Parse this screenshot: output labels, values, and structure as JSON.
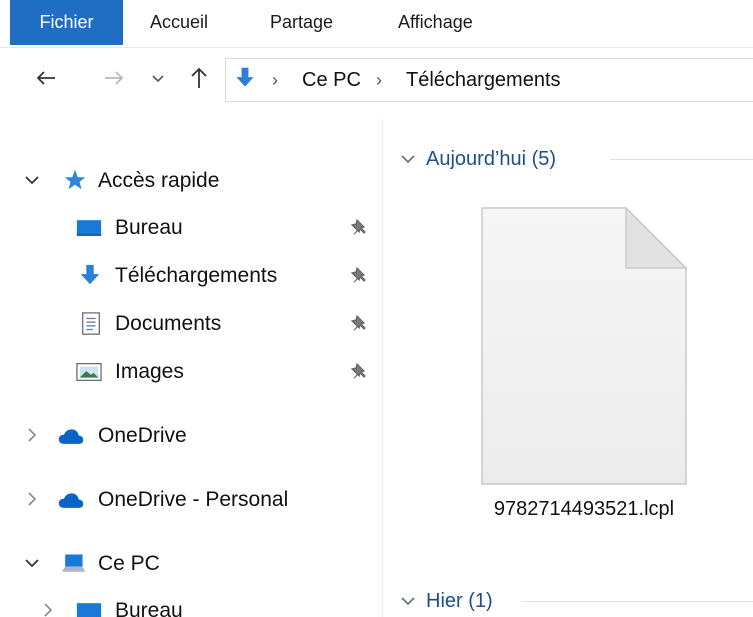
{
  "ribbon": {
    "tabs": [
      {
        "label": "Fichier",
        "active": true
      },
      {
        "label": "Accueil"
      },
      {
        "label": "Partage"
      },
      {
        "label": "Affichage"
      }
    ]
  },
  "address": {
    "crumbs": [
      "Ce PC",
      "Téléchargements"
    ]
  },
  "nav": {
    "quick_access": {
      "label": "Accès rapide",
      "expanded": true,
      "items": [
        {
          "label": "Bureau",
          "icon": "desktop-icon",
          "pinned": true
        },
        {
          "label": "Téléchargements",
          "icon": "download-arrow-icon",
          "pinned": true
        },
        {
          "label": "Documents",
          "icon": "document-icon",
          "pinned": true
        },
        {
          "label": "Images",
          "icon": "pictures-icon",
          "pinned": true
        }
      ]
    },
    "onedrive": {
      "label": "OneDrive",
      "expanded": false
    },
    "onedrive_personal": {
      "label": "OneDrive - Personal",
      "expanded": false
    },
    "this_pc": {
      "label": "Ce PC",
      "expanded": true,
      "items": [
        {
          "label": "Bureau",
          "icon": "desktop-icon"
        }
      ]
    }
  },
  "content": {
    "groups": [
      {
        "label": "Aujourd’hui (5)",
        "expanded": true
      },
      {
        "label": "Hier (1)",
        "expanded": true
      }
    ],
    "files": [
      {
        "name": "9782714493521.lcpl",
        "icon": "generic-file-icon"
      }
    ]
  },
  "colors": {
    "accent": "#1f6ec4",
    "group_header": "#1e4e8c",
    "star": "#2b88d8",
    "onedrive": "#0a64c8"
  }
}
